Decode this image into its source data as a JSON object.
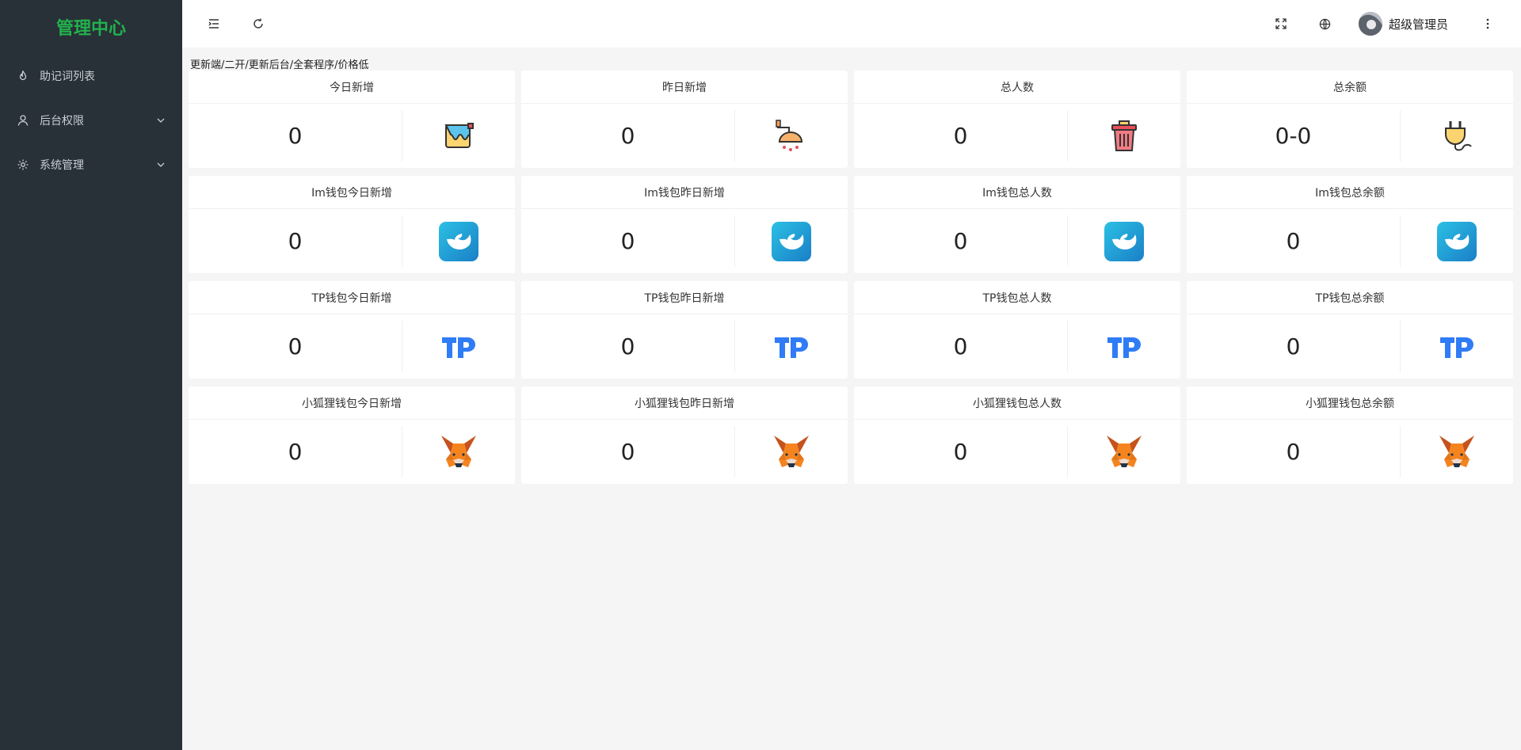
{
  "sidebar": {
    "brand": "管理中心",
    "items": [
      {
        "label": "助记词列表",
        "icon": "fire-icon",
        "has_arrow": false
      },
      {
        "label": "后台权限",
        "icon": "user-icon",
        "has_arrow": true
      },
      {
        "label": "系统管理",
        "icon": "gear-icon",
        "has_arrow": true
      }
    ]
  },
  "header": {
    "user_name": "超级管理员"
  },
  "notice": "更新端/二开/更新后台/全套程序/价格低",
  "cards": [
    {
      "title": "今日新增",
      "value": "0",
      "icon": "paint-bucket-icon"
    },
    {
      "title": "昨日新增",
      "value": "0",
      "icon": "shower-icon"
    },
    {
      "title": "总人数",
      "value": "0",
      "icon": "trash-can-icon"
    },
    {
      "title": "总余额",
      "value": "0-0",
      "icon": "plug-icon"
    },
    {
      "title": "Im钱包今日新增",
      "value": "0",
      "icon": "imtoken-icon"
    },
    {
      "title": "Im钱包昨日新增",
      "value": "0",
      "icon": "imtoken-icon"
    },
    {
      "title": "Im钱包总人数",
      "value": "0",
      "icon": "imtoken-icon"
    },
    {
      "title": "Im钱包总余额",
      "value": "0",
      "icon": "imtoken-icon"
    },
    {
      "title": "TP钱包今日新增",
      "value": "0",
      "icon": "tp-wallet-icon"
    },
    {
      "title": "TP钱包昨日新增",
      "value": "0",
      "icon": "tp-wallet-icon"
    },
    {
      "title": "TP钱包总人数",
      "value": "0",
      "icon": "tp-wallet-icon"
    },
    {
      "title": "TP钱包总余额",
      "value": "0",
      "icon": "tp-wallet-icon"
    },
    {
      "title": "小狐狸钱包今日新增",
      "value": "0",
      "icon": "metamask-fox-icon"
    },
    {
      "title": "小狐狸钱包昨日新增",
      "value": "0",
      "icon": "metamask-fox-icon"
    },
    {
      "title": "小狐狸钱包总人数",
      "value": "0",
      "icon": "metamask-fox-icon"
    },
    {
      "title": "小狐狸钱包总余额",
      "value": "0",
      "icon": "metamask-fox-icon"
    }
  ],
  "colors": {
    "sidebar_bg": "#283038",
    "brand": "#22b14c",
    "tp_blue": "#2f7cf6",
    "imtoken_blue": "#1e9bd7"
  }
}
